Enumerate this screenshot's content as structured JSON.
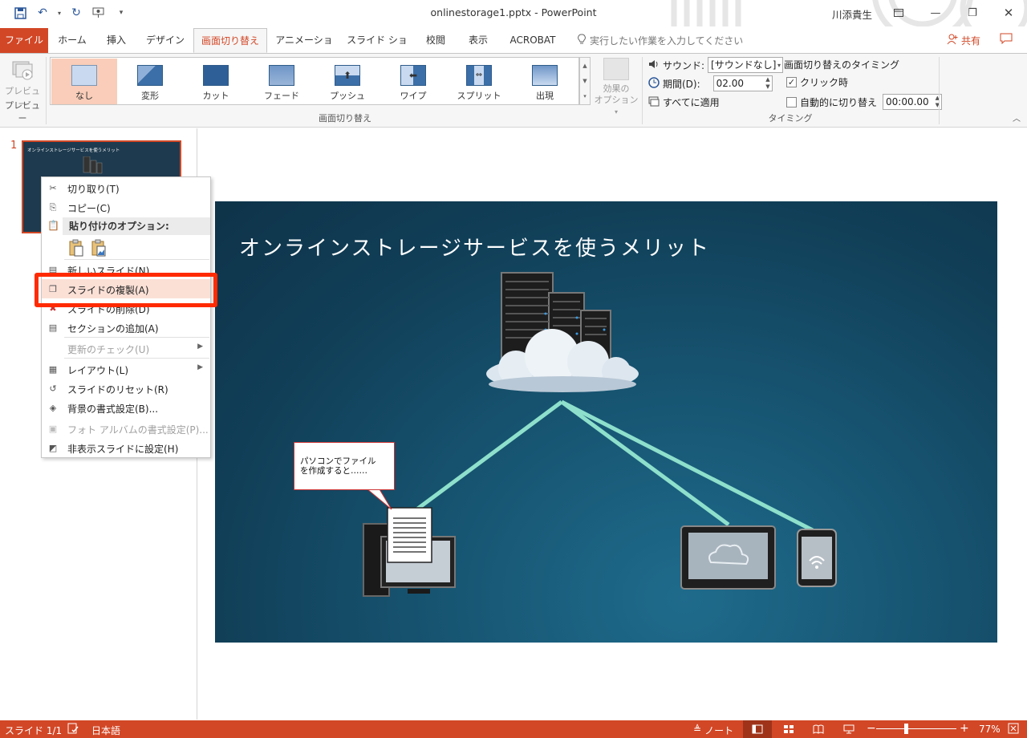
{
  "window": {
    "title": "onlinestorage1.pptx - PowerPoint",
    "user": "川添貴生"
  },
  "tabs": [
    {
      "label": "ファイル"
    },
    {
      "label": "ホーム"
    },
    {
      "label": "挿入"
    },
    {
      "label": "デザイン"
    },
    {
      "label": "画面切り替え",
      "active": true
    },
    {
      "label": "アニメーション"
    },
    {
      "label": "スライド ショー"
    },
    {
      "label": "校閲"
    },
    {
      "label": "表示"
    },
    {
      "label": "ACROBAT"
    }
  ],
  "tell_me": "実行したい作業を入力してください",
  "share": "共有",
  "ribbon": {
    "preview_label": "プレビュー",
    "preview_group": "プレビュー",
    "transitions_group": "画面切り替え",
    "transitions": [
      {
        "label": "なし",
        "selected": true
      },
      {
        "label": "変形"
      },
      {
        "label": "カット"
      },
      {
        "label": "フェード"
      },
      {
        "label": "プッシュ"
      },
      {
        "label": "ワイプ"
      },
      {
        "label": "スプリット"
      },
      {
        "label": "出現"
      }
    ],
    "effect_options": [
      "効果の",
      "オプション"
    ],
    "timing_group": "タイミング",
    "sound_label": "サウンド:",
    "sound_value": "[サウンドなし]",
    "duration_label": "期間(D):",
    "duration_value": "02.00",
    "apply_all": "すべてに適用",
    "timing_header": "画面切り替えのタイミング",
    "on_click_label": "クリック時",
    "on_click_checked": true,
    "after_label": "自動的に切り替え",
    "after_checked": false,
    "after_value": "00:00.00"
  },
  "thumbnails": {
    "number": "1",
    "title": "オンラインストレージサービスを使うメリット"
  },
  "context_menu": {
    "cut": "切り取り(T)",
    "copy": "コピー(C)",
    "paste_header": "貼り付けのオプション:",
    "new_slide": "新しいスライド(N)",
    "duplicate": "スライドの複製(A)",
    "delete": "スライドの削除(D)",
    "add_section": "セクションの追加(A)",
    "check_updates": "更新のチェック(U)",
    "layout": "レイアウト(L)",
    "reset": "スライドのリセット(R)",
    "format_bg": "背景の書式設定(B)...",
    "photo_album": "フォト アルバムの書式設定(P)...",
    "hide_slide": "非表示スライドに設定(H)"
  },
  "slide": {
    "title": "オンラインストレージサービスを使うメリット",
    "callout": "パソコンでファイル\nを作成すると……"
  },
  "status": {
    "slide_index": "スライド 1/1",
    "language": "日本語",
    "notes": "ノート",
    "zoom": "77%",
    "zoom_value": 77
  },
  "colors": {
    "accent": "#d24726",
    "highlight": "#ff2a00",
    "slide_bg": "#175673",
    "link_lines": "#8ee0cc"
  }
}
